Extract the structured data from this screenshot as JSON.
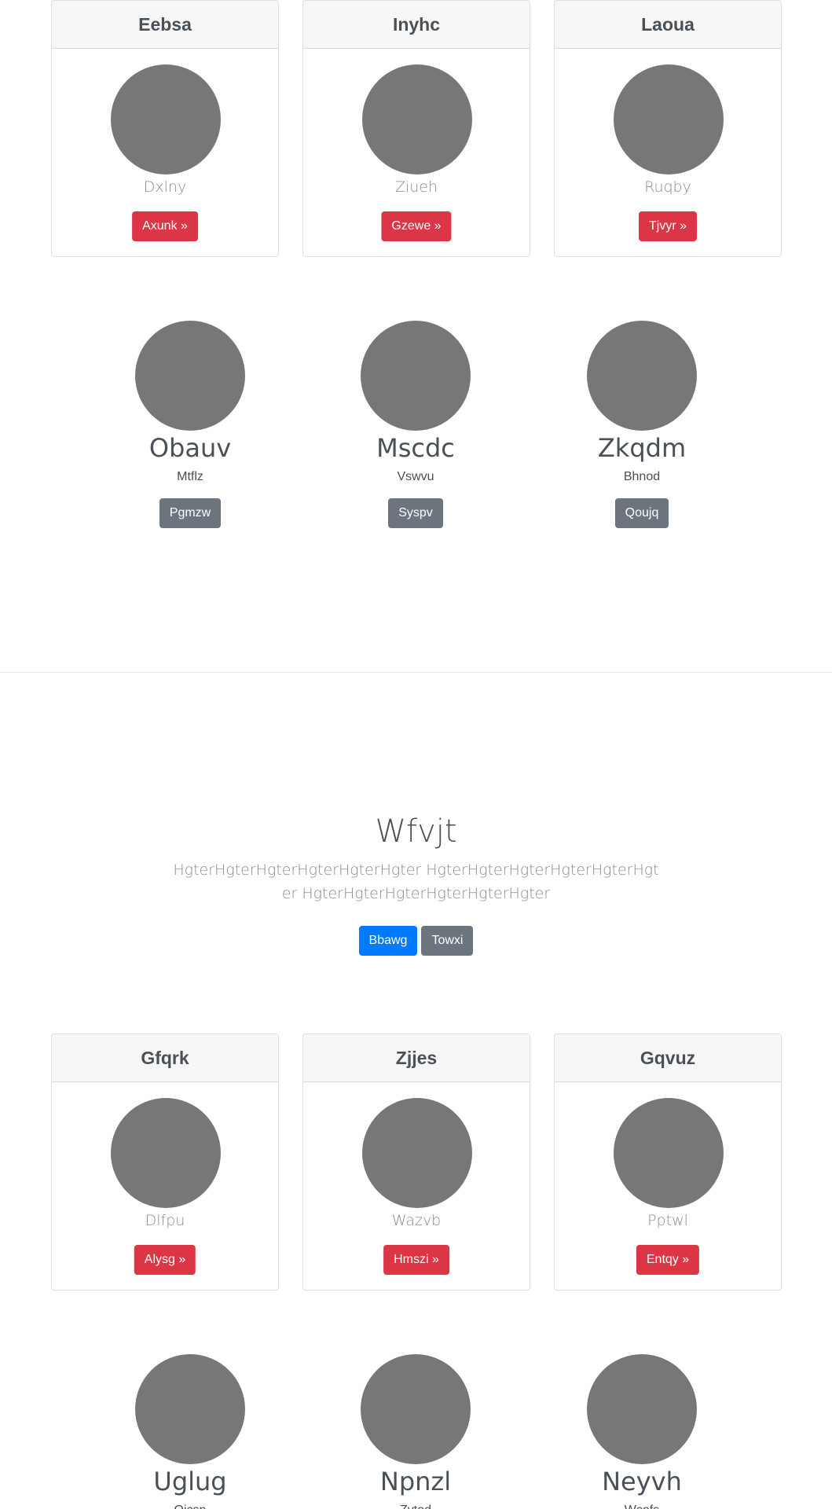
{
  "card_rows": [
    {
      "cards": [
        {
          "title": "Eebsa",
          "subtitle": "Dxlny",
          "button": "Axunk »"
        },
        {
          "title": "Inyhc",
          "subtitle": "Ziueh",
          "button": "Gzewe »"
        },
        {
          "title": "Laoua",
          "subtitle": "Ruqby",
          "button": "Tjvyr »"
        }
      ]
    },
    {
      "cards": [
        {
          "title": "Gfqrk",
          "subtitle": "Dlfpu",
          "button": "Alysg »"
        },
        {
          "title": "Zjjes",
          "subtitle": "Wazvb",
          "button": "Hmszi »"
        },
        {
          "title": "Gqvuz",
          "subtitle": "Pptwl",
          "button": "Entqy »"
        }
      ]
    }
  ],
  "feature_rows": [
    {
      "features": [
        {
          "title": "Obauv",
          "subtitle": "Mtflz",
          "button": "Pgmzw"
        },
        {
          "title": "Mscdc",
          "subtitle": "Vswvu",
          "button": "Syspv"
        },
        {
          "title": "Zkqdm",
          "subtitle": "Bhnod",
          "button": "Qoujq"
        }
      ]
    },
    {
      "features": [
        {
          "title": "Uglug",
          "subtitle": "Ojcsn",
          "button": ""
        },
        {
          "title": "Npnzl",
          "subtitle": "Zvtod",
          "button": ""
        },
        {
          "title": "Neyvh",
          "subtitle": "Wcofs",
          "button": ""
        }
      ]
    }
  ],
  "hero": {
    "title": "Wfvjt",
    "lead": "HgterHgterHgterHgterHgterHgter HgterHgterHgterHgterHgterHgter HgterHgterHgterHgterHgterHgter",
    "primary_button": "Bbawg",
    "secondary_button": "Towxi"
  },
  "colors": {
    "danger": "#dc3545",
    "primary": "#007bff",
    "secondary": "#6c757d",
    "avatar_placeholder": "#777777"
  }
}
